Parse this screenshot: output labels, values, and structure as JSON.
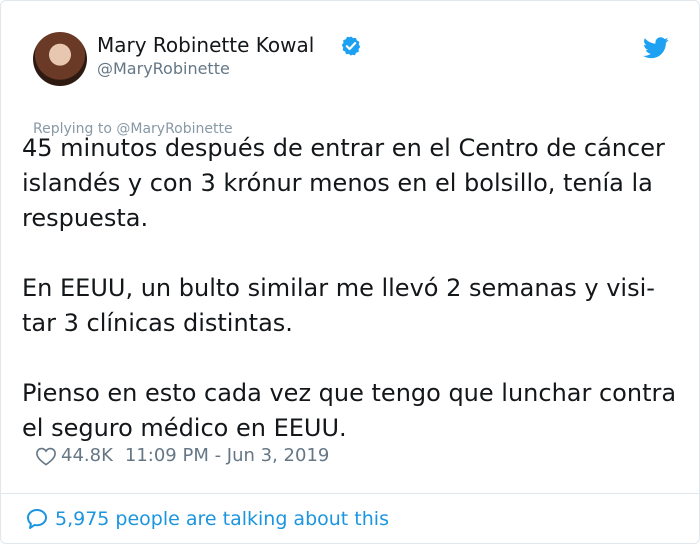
{
  "author": {
    "name": "Mary Robinette Kowal",
    "handle": "@MaryRobinette",
    "verified": true,
    "avatar_icon": "avatar-photo"
  },
  "platform_icon": "twitter-bird-icon",
  "reply_context": "Replying to @MaryRobinette",
  "tweet": {
    "text": "45 minutos después de entrar en el Centro de cáncer islandés y con 3 krónur menos en el bolsillo, tenía la respuesta.\n\nEn EEUU, un bulto similar me llevó 2 semanas y visi-tar 3 clínicas distintas.\n\nPienso en esto cada vez que tengo que lunchar contra el seguro médico en EEUU.",
    "likes": "44.8K",
    "timestamp": "11:09 PM - Jun 3, 2019"
  },
  "footer": {
    "talking_text": "5,975 people are talking about this"
  },
  "colors": {
    "twitter_blue": "#1da1f2",
    "link_blue": "#1b95e0",
    "secondary_text": "#657786",
    "border": "#e1e8ed"
  }
}
